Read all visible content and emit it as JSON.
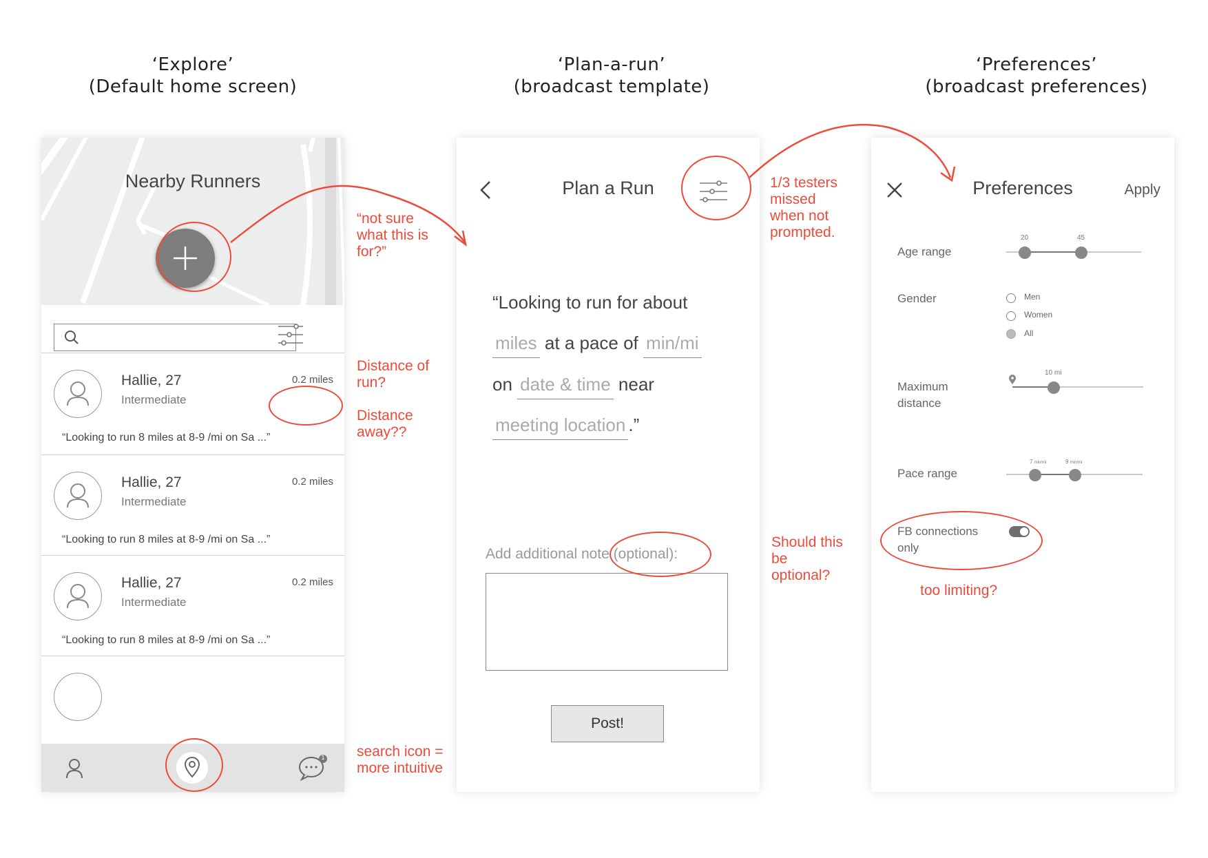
{
  "headings": {
    "explore": {
      "title": "‘Explore’",
      "subtitle": "(Default home screen)"
    },
    "plan": {
      "title": "‘Plan-a-run’",
      "subtitle": "(broadcast template)"
    },
    "prefs": {
      "title": "‘Preferences’",
      "subtitle": "(broadcast preferences)"
    }
  },
  "explore": {
    "title": "Nearby Runners",
    "search": {
      "value": "",
      "icon": "search-icon"
    },
    "cards": [
      {
        "name": "Hallie, 27",
        "level": "Intermediate",
        "distance": "0.2 miles",
        "quote": "“Looking to run 8 miles at 8-9 /mi on Sa ...”"
      },
      {
        "name": "Hallie, 27",
        "level": "Intermediate",
        "distance": "0.2 miles",
        "quote": "“Looking to run 8 miles at 8-9 /mi on Sa ...”"
      },
      {
        "name": "Hallie, 27",
        "level": "Intermediate",
        "distance": "0.2 miles",
        "quote": "“Looking to run 8 miles at 8-9 /mi on Sa ...”"
      }
    ],
    "tabs": {
      "profile": "person-icon",
      "explore": "location-pin-icon",
      "messages": "chat-bubble-icon",
      "message_badge": "1"
    }
  },
  "plan": {
    "title": "Plan a Run",
    "line1": "“Looking to run for about",
    "miles": "miles",
    "pace_text": "at a pace of",
    "pace": "min/mi",
    "on_text": "on",
    "datetime": "date & time",
    "near_text": "near",
    "location": "meeting location",
    "close_quote": ".”",
    "note_label": "Add additional note (optional):",
    "note_value": "",
    "post_label": "Post!"
  },
  "prefs": {
    "title": "Preferences",
    "apply_label": "Apply",
    "age": {
      "label": "Age range",
      "min": "20",
      "max": "45"
    },
    "gender": {
      "label": "Gender",
      "options": [
        "Men",
        "Women",
        "All"
      ],
      "selected": "All"
    },
    "distance": {
      "label_1": "Maximum",
      "label_2": "distance",
      "value": "10 mi"
    },
    "pace": {
      "label": "Pace range",
      "min": "7",
      "max": "9",
      "unit": "min/mi"
    },
    "fb": {
      "label_1": "FB connections",
      "label_2": "only",
      "on": true
    }
  },
  "annotations": {
    "fab_1": "“not sure",
    "fab_2": "what this is",
    "fab_3": "for?”",
    "dist_run_1": "Distance of",
    "dist_run_2": "run?",
    "dist_away_1": "Distance",
    "dist_away_2": "away??",
    "search_1": "search icon =",
    "search_2": "more intuitive",
    "testers_1": "1/3 testers",
    "testers_2": "missed",
    "testers_3": "when not",
    "testers_4": "prompted.",
    "optional_1": "Should this",
    "optional_2": "be",
    "optional_3": "optional?",
    "limiting": "too limiting?"
  },
  "colors": {
    "annotation": "#ee4a3a",
    "fab": "#7d7d7d",
    "map": "#eceded"
  }
}
